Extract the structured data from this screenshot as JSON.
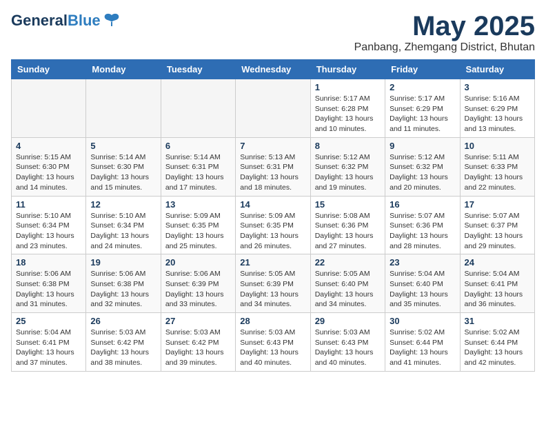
{
  "header": {
    "logo_line1": "General",
    "logo_line2": "Blue",
    "month_year": "May 2025",
    "location": "Panbang, Zhemgang District, Bhutan"
  },
  "weekdays": [
    "Sunday",
    "Monday",
    "Tuesday",
    "Wednesday",
    "Thursday",
    "Friday",
    "Saturday"
  ],
  "weeks": [
    [
      {
        "day": "",
        "info": ""
      },
      {
        "day": "",
        "info": ""
      },
      {
        "day": "",
        "info": ""
      },
      {
        "day": "",
        "info": ""
      },
      {
        "day": "1",
        "info": "Sunrise: 5:17 AM\nSunset: 6:28 PM\nDaylight: 13 hours\nand 10 minutes."
      },
      {
        "day": "2",
        "info": "Sunrise: 5:17 AM\nSunset: 6:29 PM\nDaylight: 13 hours\nand 11 minutes."
      },
      {
        "day": "3",
        "info": "Sunrise: 5:16 AM\nSunset: 6:29 PM\nDaylight: 13 hours\nand 13 minutes."
      }
    ],
    [
      {
        "day": "4",
        "info": "Sunrise: 5:15 AM\nSunset: 6:30 PM\nDaylight: 13 hours\nand 14 minutes."
      },
      {
        "day": "5",
        "info": "Sunrise: 5:14 AM\nSunset: 6:30 PM\nDaylight: 13 hours\nand 15 minutes."
      },
      {
        "day": "6",
        "info": "Sunrise: 5:14 AM\nSunset: 6:31 PM\nDaylight: 13 hours\nand 17 minutes."
      },
      {
        "day": "7",
        "info": "Sunrise: 5:13 AM\nSunset: 6:31 PM\nDaylight: 13 hours\nand 18 minutes."
      },
      {
        "day": "8",
        "info": "Sunrise: 5:12 AM\nSunset: 6:32 PM\nDaylight: 13 hours\nand 19 minutes."
      },
      {
        "day": "9",
        "info": "Sunrise: 5:12 AM\nSunset: 6:32 PM\nDaylight: 13 hours\nand 20 minutes."
      },
      {
        "day": "10",
        "info": "Sunrise: 5:11 AM\nSunset: 6:33 PM\nDaylight: 13 hours\nand 22 minutes."
      }
    ],
    [
      {
        "day": "11",
        "info": "Sunrise: 5:10 AM\nSunset: 6:34 PM\nDaylight: 13 hours\nand 23 minutes."
      },
      {
        "day": "12",
        "info": "Sunrise: 5:10 AM\nSunset: 6:34 PM\nDaylight: 13 hours\nand 24 minutes."
      },
      {
        "day": "13",
        "info": "Sunrise: 5:09 AM\nSunset: 6:35 PM\nDaylight: 13 hours\nand 25 minutes."
      },
      {
        "day": "14",
        "info": "Sunrise: 5:09 AM\nSunset: 6:35 PM\nDaylight: 13 hours\nand 26 minutes."
      },
      {
        "day": "15",
        "info": "Sunrise: 5:08 AM\nSunset: 6:36 PM\nDaylight: 13 hours\nand 27 minutes."
      },
      {
        "day": "16",
        "info": "Sunrise: 5:07 AM\nSunset: 6:36 PM\nDaylight: 13 hours\nand 28 minutes."
      },
      {
        "day": "17",
        "info": "Sunrise: 5:07 AM\nSunset: 6:37 PM\nDaylight: 13 hours\nand 29 minutes."
      }
    ],
    [
      {
        "day": "18",
        "info": "Sunrise: 5:06 AM\nSunset: 6:38 PM\nDaylight: 13 hours\nand 31 minutes."
      },
      {
        "day": "19",
        "info": "Sunrise: 5:06 AM\nSunset: 6:38 PM\nDaylight: 13 hours\nand 32 minutes."
      },
      {
        "day": "20",
        "info": "Sunrise: 5:06 AM\nSunset: 6:39 PM\nDaylight: 13 hours\nand 33 minutes."
      },
      {
        "day": "21",
        "info": "Sunrise: 5:05 AM\nSunset: 6:39 PM\nDaylight: 13 hours\nand 34 minutes."
      },
      {
        "day": "22",
        "info": "Sunrise: 5:05 AM\nSunset: 6:40 PM\nDaylight: 13 hours\nand 34 minutes."
      },
      {
        "day": "23",
        "info": "Sunrise: 5:04 AM\nSunset: 6:40 PM\nDaylight: 13 hours\nand 35 minutes."
      },
      {
        "day": "24",
        "info": "Sunrise: 5:04 AM\nSunset: 6:41 PM\nDaylight: 13 hours\nand 36 minutes."
      }
    ],
    [
      {
        "day": "25",
        "info": "Sunrise: 5:04 AM\nSunset: 6:41 PM\nDaylight: 13 hours\nand 37 minutes."
      },
      {
        "day": "26",
        "info": "Sunrise: 5:03 AM\nSunset: 6:42 PM\nDaylight: 13 hours\nand 38 minutes."
      },
      {
        "day": "27",
        "info": "Sunrise: 5:03 AM\nSunset: 6:42 PM\nDaylight: 13 hours\nand 39 minutes."
      },
      {
        "day": "28",
        "info": "Sunrise: 5:03 AM\nSunset: 6:43 PM\nDaylight: 13 hours\nand 40 minutes."
      },
      {
        "day": "29",
        "info": "Sunrise: 5:03 AM\nSunset: 6:43 PM\nDaylight: 13 hours\nand 40 minutes."
      },
      {
        "day": "30",
        "info": "Sunrise: 5:02 AM\nSunset: 6:44 PM\nDaylight: 13 hours\nand 41 minutes."
      },
      {
        "day": "31",
        "info": "Sunrise: 5:02 AM\nSunset: 6:44 PM\nDaylight: 13 hours\nand 42 minutes."
      }
    ]
  ]
}
